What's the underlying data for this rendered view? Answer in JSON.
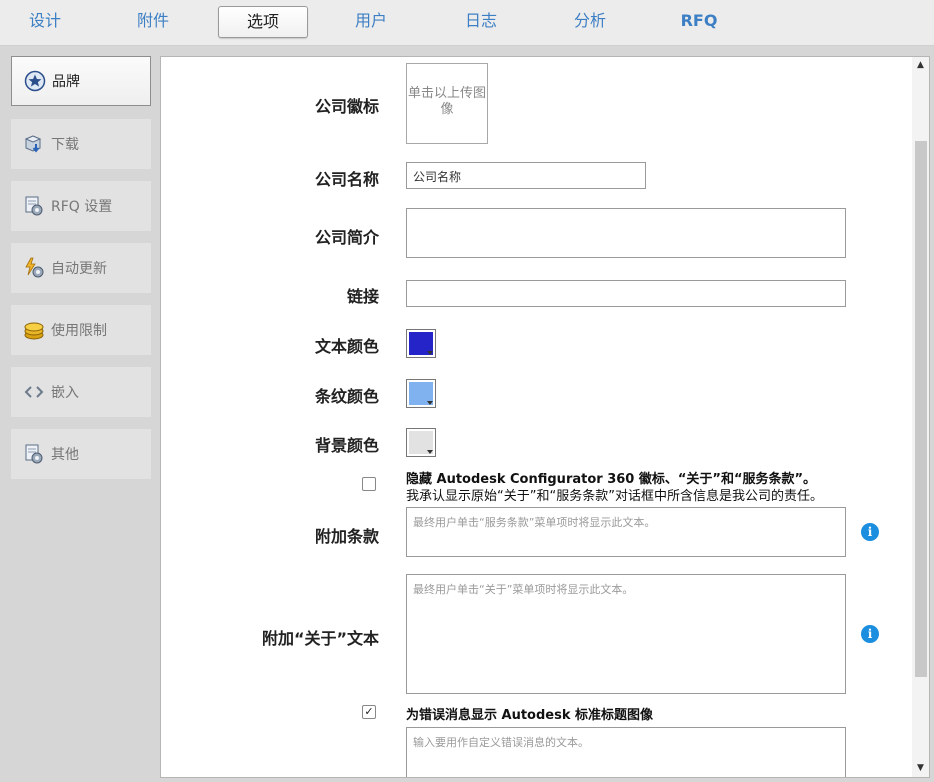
{
  "top_tabs": [
    {
      "label": "设计"
    },
    {
      "label": "附件"
    },
    {
      "label": "选项"
    },
    {
      "label": "用户"
    },
    {
      "label": "日志"
    },
    {
      "label": "分析"
    },
    {
      "label": "RFQ"
    }
  ],
  "active_tab": "选项",
  "sidebar": {
    "items": [
      {
        "label": "品牌",
        "icon": "star-badge-icon"
      },
      {
        "label": "下载",
        "icon": "download-box-icon"
      },
      {
        "label": "RFQ 设置",
        "icon": "rfq-settings-icon"
      },
      {
        "label": "自动更新",
        "icon": "auto-update-icon"
      },
      {
        "label": "使用限制",
        "icon": "coins-icon"
      },
      {
        "label": "嵌入",
        "icon": "embed-code-icon"
      },
      {
        "label": "其他",
        "icon": "other-settings-icon"
      }
    ]
  },
  "form": {
    "logo": {
      "label": "公司徽标",
      "upload_text": "单击以上传图像"
    },
    "company_name": {
      "label": "公司名称",
      "value": "公司名称"
    },
    "company_intro": {
      "label": "公司简介",
      "value": ""
    },
    "link": {
      "label": "链接",
      "value": ""
    },
    "text_color": {
      "label": "文本颜色",
      "color": "#2424c8"
    },
    "stripe_color": {
      "label": "条纹颜色",
      "color": "#7fb2ee"
    },
    "background_color": {
      "label": "背景颜色",
      "color": "#e2e2e2"
    },
    "hide_branding": {
      "checked": false,
      "title": "隐藏 Autodesk Configurator 360 徽标、“关于”和“服务条款”。",
      "description": "我承认显示原始“关于”和“服务条款”对话框中所含信息是我公司的责任。"
    },
    "additional_terms": {
      "label": "附加条款",
      "placeholder": "最终用户单击“服务条款”菜单项时将显示此文本。"
    },
    "additional_about": {
      "label": "附加“关于”文本",
      "placeholder": "最终用户单击“关于”菜单项时将显示此文本。"
    },
    "error_header": {
      "checked": true,
      "label": "为错误消息显示 Autodesk 标准标题图像"
    },
    "error_message": {
      "placeholder": "输入要用作自定义错误消息的文本。"
    }
  }
}
